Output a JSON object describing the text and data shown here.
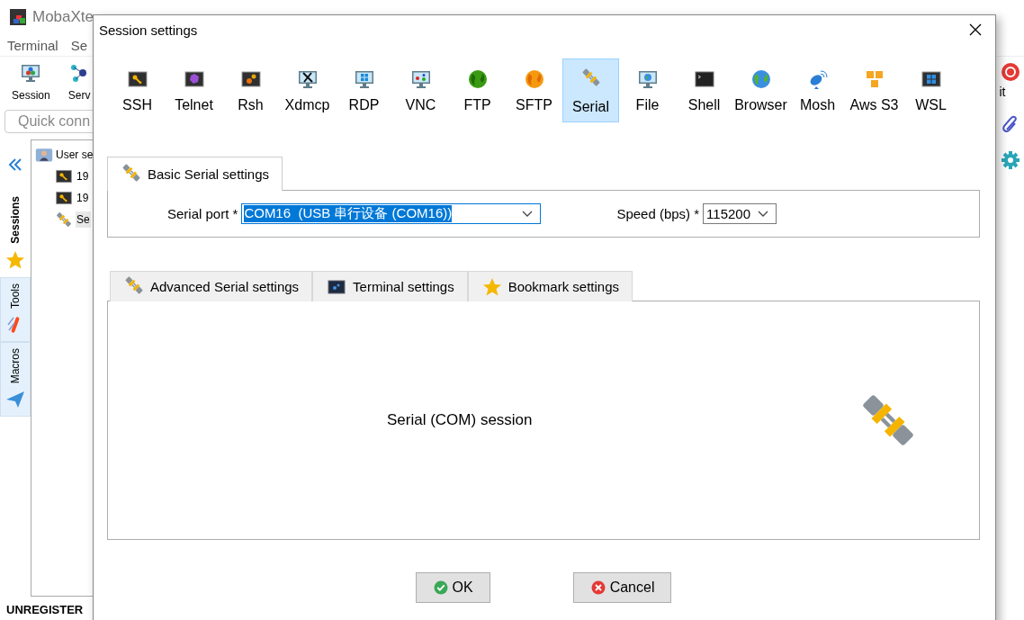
{
  "app": {
    "title": "MobaXte",
    "menu": [
      "Terminal",
      "Se"
    ],
    "toolbar": [
      {
        "label": "Session",
        "kind": "session"
      },
      {
        "label": "Serv",
        "kind": "servers"
      }
    ],
    "quick_connect": {
      "placeholder": "Quick conn"
    },
    "side_tabs": [
      {
        "label": "Sessions",
        "kind": "star",
        "selected": true
      },
      {
        "label": "Tools",
        "kind": "tools",
        "selected": false
      },
      {
        "label": "Macros",
        "kind": "macros",
        "selected": false
      }
    ],
    "tree": {
      "label": "User se",
      "children": [
        {
          "label": "19",
          "kind": "ssh",
          "selected": false
        },
        {
          "label": "19",
          "kind": "ssh",
          "selected": false
        },
        {
          "label": "Se",
          "kind": "serial",
          "selected": true
        }
      ]
    },
    "right_toolbar": [
      {
        "label": "it",
        "kind": "exit"
      },
      {
        "kind": "clip"
      },
      {
        "kind": "gear"
      }
    ],
    "status_bar": "UNREGISTER"
  },
  "dialog": {
    "title": "Session settings",
    "session_types": [
      {
        "label": "SSH",
        "kind": "ssh",
        "selected": false
      },
      {
        "label": "Telnet",
        "kind": "telnet",
        "selected": false
      },
      {
        "label": "Rsh",
        "kind": "rsh",
        "selected": false
      },
      {
        "label": "Xdmcp",
        "kind": "xdmcp",
        "selected": false
      },
      {
        "label": "RDP",
        "kind": "rdp",
        "selected": false
      },
      {
        "label": "VNC",
        "kind": "vnc",
        "selected": false
      },
      {
        "label": "FTP",
        "kind": "ftp",
        "selected": false
      },
      {
        "label": "SFTP",
        "kind": "sftp",
        "selected": false
      },
      {
        "label": "Serial",
        "kind": "serial",
        "selected": true
      },
      {
        "label": "File",
        "kind": "file",
        "selected": false
      },
      {
        "label": "Shell",
        "kind": "shell",
        "selected": false
      },
      {
        "label": "Browser",
        "kind": "browser",
        "selected": false
      },
      {
        "label": "Mosh",
        "kind": "mosh",
        "selected": false
      },
      {
        "label": "Aws S3",
        "kind": "aws",
        "selected": false
      },
      {
        "label": "WSL",
        "kind": "wsl",
        "selected": false
      }
    ],
    "basic_tab": {
      "label": "Basic Serial settings",
      "selected": true
    },
    "serial_port": {
      "label": "Serial port *",
      "value": "COM16  (USB 串行设备 (COM16))"
    },
    "speed": {
      "label": "Speed (bps) *",
      "value": "115200"
    },
    "tabs": [
      {
        "label": "Advanced Serial settings",
        "kind": "serial",
        "selected": false
      },
      {
        "label": "Terminal settings",
        "kind": "terminal",
        "selected": false
      },
      {
        "label": "Bookmark settings",
        "kind": "star",
        "selected": false
      }
    ],
    "description": "Serial (COM) session",
    "buttons": [
      {
        "label": "OK",
        "kind": "ok"
      },
      {
        "label": "Cancel",
        "kind": "cancel"
      }
    ]
  }
}
